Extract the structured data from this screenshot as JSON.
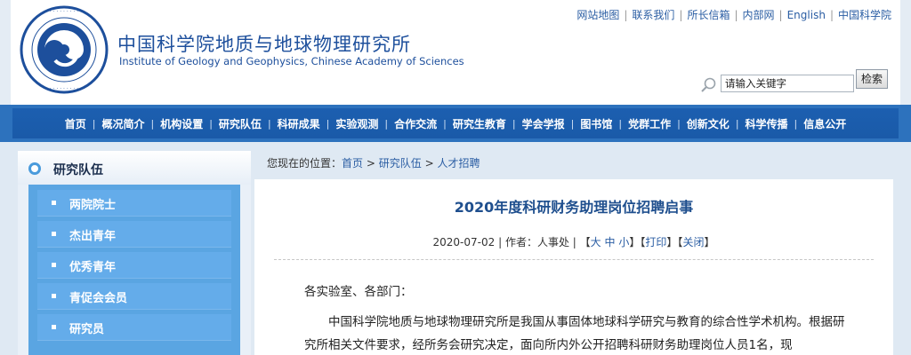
{
  "header": {
    "name_cn": "中国科学院地质与地球物理研究所",
    "name_en": "Institute of Geology and Geophysics, Chinese Academy of Sciences",
    "top_links": [
      "网站地图",
      "联系我们",
      "所长信箱",
      "内部网",
      "English",
      "中国科学院"
    ],
    "search_placeholder": "请输入关键字",
    "search_button": "检索"
  },
  "nav": {
    "items": [
      "首页",
      "概况简介",
      "机构设置",
      "研究队伍",
      "科研成果",
      "实验观测",
      "合作交流",
      "研究生教育",
      "学会学报",
      "图书馆",
      "党群工作",
      "创新文化",
      "科学传播",
      "信息公开"
    ]
  },
  "sidebar": {
    "title": "研究队伍",
    "items": [
      "两院院士",
      "杰出青年",
      "优秀青年",
      "青促会会员",
      "研究员"
    ]
  },
  "breadcrumb": {
    "prefix": "您现在的位置：",
    "items": [
      "首页",
      "研究队伍",
      "人才招聘"
    ],
    "separator": ">"
  },
  "article": {
    "title": "2020年度科研财务助理岗位招聘启事",
    "date": "2020-07-02",
    "author_label": "作者：",
    "author": "人事处",
    "font_sizes": [
      "大",
      "中",
      "小"
    ],
    "print": "打印",
    "close": "关闭",
    "greeting": "各实验室、各部门：",
    "paragraph": "中国科学院地质与地球物理研究所是我国从事固体地球科学研究与教育的综合性学术机构。根据研究所相关文件要求，经所务会研究决定，面向所内外公开招聘科研财务助理岗位人员1名，现"
  },
  "colors": {
    "brand_blue": "#1d4f9c",
    "nav_blue": "#1c5fb0",
    "sidebar_blue": "#5aa5e2"
  }
}
